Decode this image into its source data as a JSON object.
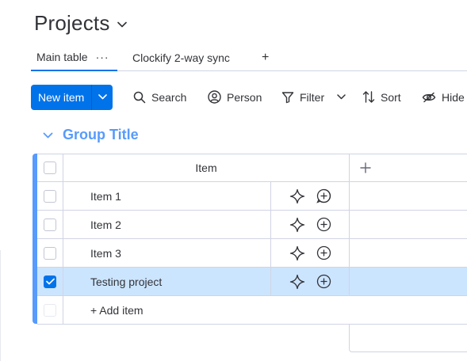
{
  "board": {
    "title": "Projects"
  },
  "tabs": [
    {
      "label": "Main table",
      "menu": "···"
    },
    {
      "label": "Clockify 2-way sync"
    },
    {
      "label": "+"
    }
  ],
  "toolbar": {
    "new_item_label": "New item",
    "search_label": "Search",
    "person_label": "Person",
    "filter_label": "Filter",
    "sort_label": "Sort",
    "hide_label": "Hide"
  },
  "group": {
    "title": "Group Title",
    "color": "#579bfc",
    "column_header": "Item",
    "rows": [
      {
        "name": "Item 1",
        "checked": false
      },
      {
        "name": "Item 2",
        "checked": false
      },
      {
        "name": "Item 3",
        "checked": false
      },
      {
        "name": "Testing project",
        "checked": true
      }
    ],
    "add_item_label": "+ Add item"
  },
  "colors": {
    "primary": "#0073ea",
    "selected_row": "#cce5ff",
    "group_accent": "#579bfc",
    "text": "#323338"
  },
  "icons": [
    "chevron-down-icon",
    "search-icon",
    "person-icon",
    "filter-icon",
    "sort-icon",
    "eye-off-icon",
    "plus-icon",
    "sparkle-icon",
    "add-update-icon",
    "checkmark-icon"
  ]
}
